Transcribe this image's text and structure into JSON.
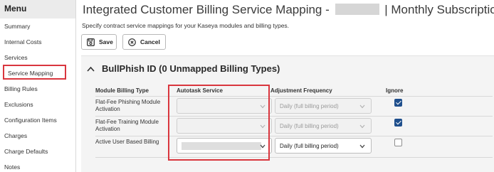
{
  "sidebar": {
    "title": "Menu",
    "items": [
      {
        "label": "Summary"
      },
      {
        "label": "Internal Costs"
      },
      {
        "label": "Services"
      },
      {
        "label": "Service Mapping",
        "active": true
      },
      {
        "label": "Billing Rules"
      },
      {
        "label": "Exclusions"
      },
      {
        "label": "Configuration Items"
      },
      {
        "label": "Charges"
      },
      {
        "label": "Charge Defaults"
      },
      {
        "label": "Notes"
      }
    ]
  },
  "header": {
    "title_prefix": "Integrated Customer Billing Service Mapping -",
    "title_suffix": "| Monthly Subscriptions",
    "subtitle": "Specify contract service mappings for your Kaseya modules and billing types."
  },
  "toolbar": {
    "save_label": "Save",
    "cancel_label": "Cancel"
  },
  "section": {
    "title": "BullPhish ID (0 Unmapped Billing Types)",
    "columns": {
      "module_billing_type": "Module Billing Type",
      "autotask_service": "Autotask Service",
      "adjustment_frequency": "Adjustment Frequency",
      "ignore": "Ignore"
    },
    "rows": [
      {
        "billing_type": "Flat-Fee Phishing Module Activation",
        "autotask_service": "",
        "adjustment_frequency": "Daily (full billing period)",
        "ignore": true,
        "enabled": false
      },
      {
        "billing_type": "Flat-Fee Training Module Activation",
        "autotask_service": "",
        "adjustment_frequency": "Daily (full billing period)",
        "ignore": true,
        "enabled": false
      },
      {
        "billing_type": "Active User Based Billing",
        "autotask_service": "",
        "adjustment_frequency": "Daily (full billing period)",
        "ignore": false,
        "enabled": true
      }
    ]
  },
  "colors": {
    "highlight": "#d9363e",
    "checkbox_checked": "#1f4f8c"
  },
  "icons": {
    "save": "floppy-disk-icon",
    "cancel": "cancel-circle-icon",
    "section_toggle": "chevron-up-icon",
    "dropdown": "chevron-down-icon"
  }
}
